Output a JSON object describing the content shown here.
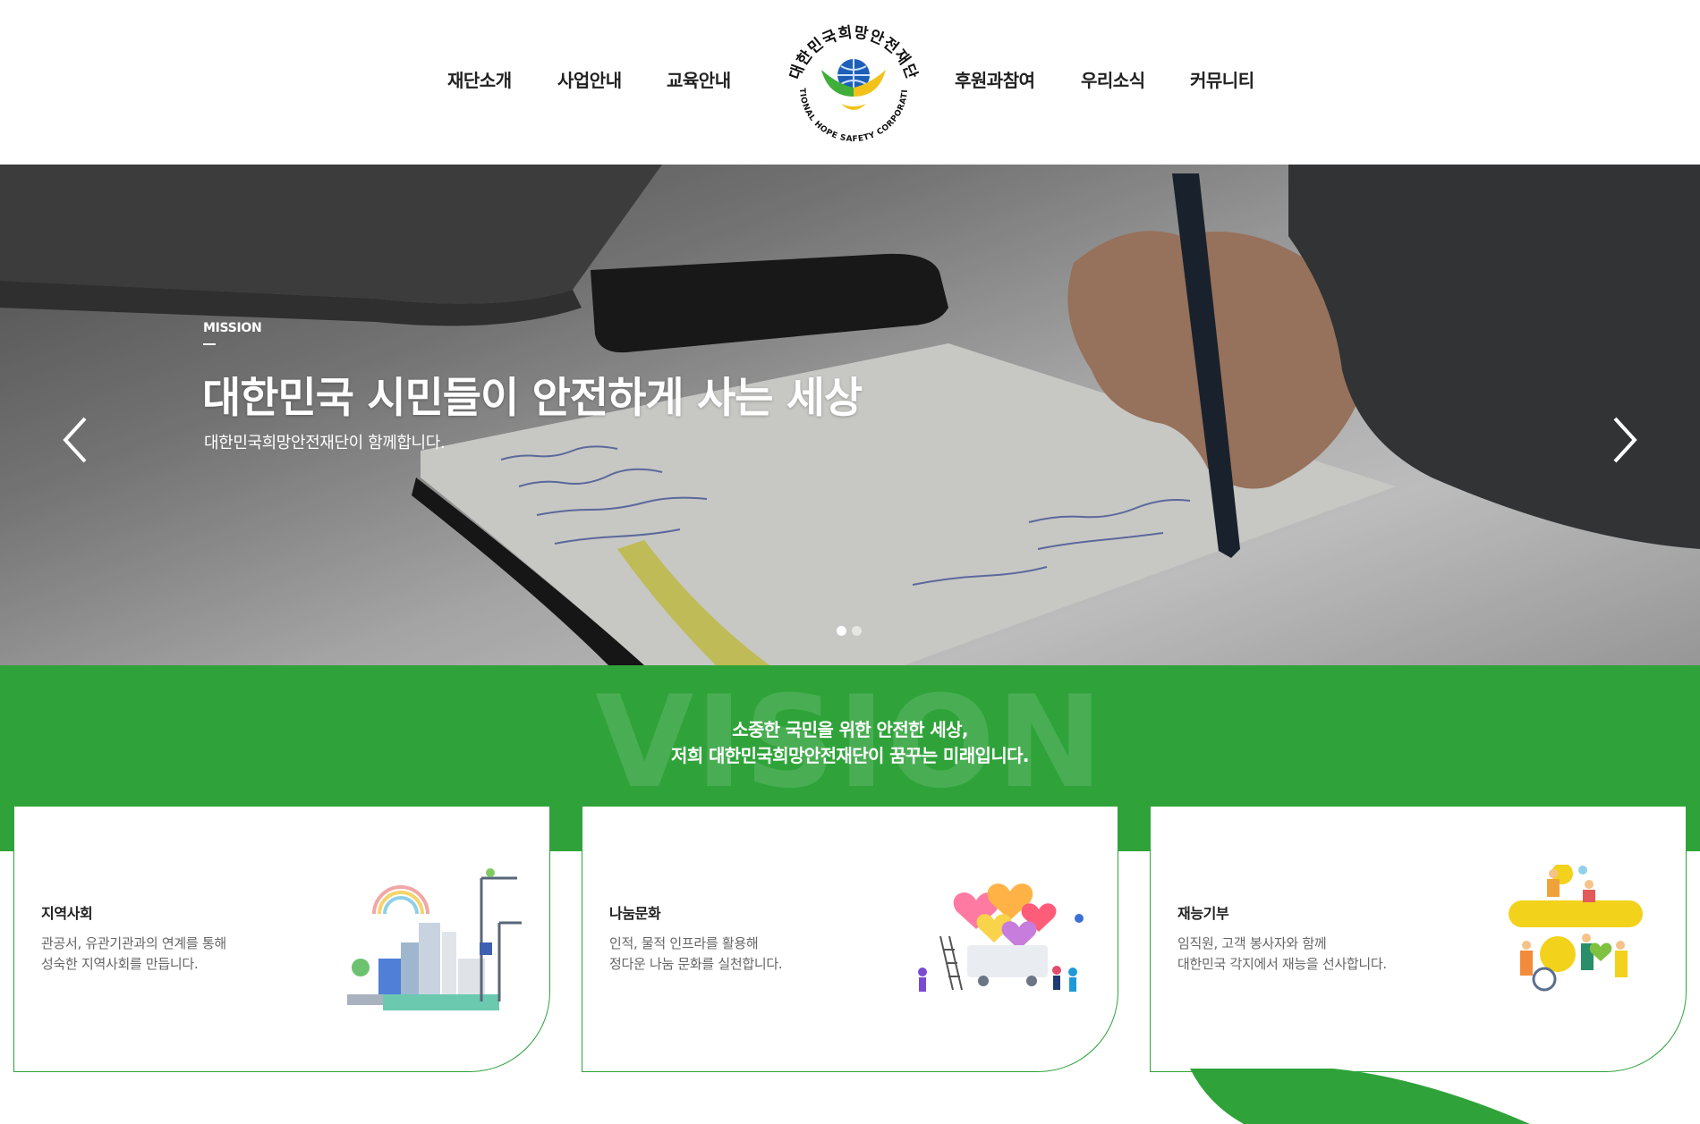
{
  "nav": {
    "left": [
      "재단소개",
      "사업안내",
      "교육안내"
    ],
    "right": [
      "후원과참여",
      "우리소식",
      "커뮤니티"
    ]
  },
  "logo": {
    "korean_name": "대한민국희망안전재단",
    "english_name": "NATIONAL HOPE SAFETY CORPORATION"
  },
  "hero": {
    "label": "MISSION",
    "title": "대한민국 시민들이 안전하게 사는 세상",
    "subtitle": "대한민국희망안전재단이 함께합니다.",
    "slide_count": 2,
    "active_slide": 1
  },
  "vision": {
    "watermark": "VISION",
    "line1": "소중한 국민을 위한 안전한 세상,",
    "line2": "저희 대한민국희망안전재단이 꿈꾸는 미래입니다."
  },
  "cards": [
    {
      "title": "지역사회",
      "desc1": "관공서, 유관기관과의 연계를 통해",
      "desc2": "성숙한 지역사회를 만듭니다.",
      "icon": "city-illustration"
    },
    {
      "title": "나눔문화",
      "desc1": "인적, 물적 인프라를 활용해",
      "desc2": "정다운 나눔 문화를 실천합니다.",
      "icon": "hearts-illustration"
    },
    {
      "title": "재능기부",
      "desc1": "임직원, 고객 봉사자와 함께",
      "desc2": "대한민국 각지에서 재능을 선사합니다.",
      "icon": "volunteers-illustration"
    }
  ],
  "colors": {
    "brand_green": "#2fa33a",
    "text_dark": "#222222",
    "text_gray": "#666666"
  }
}
